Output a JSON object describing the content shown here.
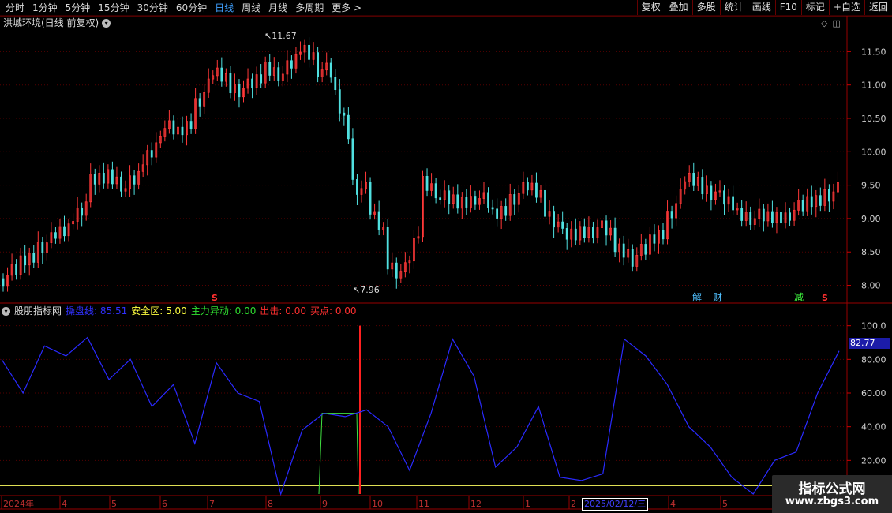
{
  "toolbar": {
    "periods": [
      "分时",
      "1分钟",
      "5分钟",
      "15分钟",
      "30分钟",
      "60分钟",
      "日线",
      "周线",
      "月线",
      "多周期",
      "更多 >"
    ],
    "active_period": "日线",
    "actions": [
      "复权",
      "叠加",
      "多股",
      "统计",
      "画线",
      "F10",
      "标记",
      "+自选",
      "返回"
    ]
  },
  "main_chart": {
    "title": "洪城环境(日线 前复权)",
    "high_label": "11.67",
    "low_label": "7.96",
    "y_ticks": [
      "11.50",
      "11.00",
      "10.50",
      "10.00",
      "9.50",
      "9.00",
      "8.50",
      "8.00"
    ],
    "markers": {
      "s1": "S",
      "jie": "解",
      "cai": "财",
      "jian": "减",
      "s2": "S"
    }
  },
  "indicator": {
    "name": "股朋指标网",
    "lines": [
      {
        "label": "操盘线:",
        "value": "85.51",
        "color": "#3030ff"
      },
      {
        "label": "安全区:",
        "value": "5.00",
        "color": "#ffff40"
      },
      {
        "label": "主力异动:",
        "value": "0.00",
        "color": "#30e030"
      },
      {
        "label": "出击:",
        "value": "0.00",
        "color": "#ff3030"
      },
      {
        "label": "买点:",
        "value": "0.00",
        "color": "#ff3030"
      }
    ],
    "y_ticks": [
      "100.0",
      "80.00",
      "60.00",
      "40.00",
      "20.00"
    ],
    "last_value": "82.77"
  },
  "x_axis": {
    "labels": [
      "2024年",
      "4",
      "5",
      "6",
      "7",
      "8",
      "9",
      "10",
      "11",
      "12",
      "1",
      "2",
      "4",
      "5"
    ],
    "cursor_date": "2025/02/12/三"
  },
  "watermark": {
    "line1": "指标公式网",
    "line2": "www.zbgs3.com"
  },
  "chart_data": {
    "type": "line",
    "candle_close_approx": [
      8.1,
      8.3,
      8.6,
      8.7,
      9.0,
      9.5,
      9.7,
      9.4,
      9.8,
      10.4,
      10.2,
      10.7,
      11.2,
      11.0,
      10.9,
      11.3,
      11.1,
      11.6,
      11.3,
      11.0,
      9.6,
      9.2,
      8.4,
      8.0,
      9.6,
      9.3,
      9.2,
      9.4,
      9.0,
      9.3,
      9.5,
      9.2,
      8.7,
      8.8,
      8.9,
      8.6,
      8.4,
      8.6,
      9.0,
      9.6,
      9.5,
      9.3,
      9.1,
      9.0,
      9.0,
      9.1,
      9.2,
      9.4
    ],
    "indicator_line": [
      80,
      60,
      88,
      82,
      93,
      68,
      80,
      52,
      65,
      30,
      78,
      60,
      55,
      0,
      38,
      48,
      46,
      50,
      40,
      14,
      48,
      92,
      70,
      16,
      28,
      52,
      10,
      8,
      12,
      92,
      82,
      65,
      40,
      28,
      10,
      0,
      20,
      25,
      60,
      85
    ],
    "ylim_main": [
      7.9,
      11.8
    ],
    "ylim_indicator": [
      0,
      105
    ]
  }
}
